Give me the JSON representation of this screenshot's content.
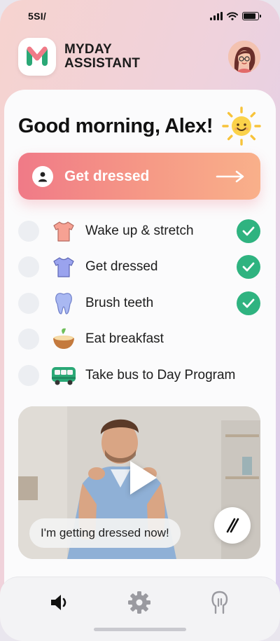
{
  "status_bar": {
    "time": "5SI/"
  },
  "header": {
    "brand_line1": "MYDAY",
    "brand_line2": "ASSISTANT",
    "logo_letter": "M"
  },
  "greeting": "Good morning, Alex!",
  "primary_action": {
    "label": "Get dressed",
    "icon": "person-icon",
    "arrow": "→"
  },
  "tasks": [
    {
      "label": "Wake up & stretch",
      "icon": "shirt-icon",
      "done": true
    },
    {
      "label": "Get dressed",
      "icon": "shirt-icon",
      "done": true
    },
    {
      "label": "Brush teeth",
      "icon": "tooth-icon",
      "done": true
    },
    {
      "label": "Eat breakfast",
      "icon": "bowl-icon",
      "done": false
    },
    {
      "label": "Take bus to Day Program",
      "icon": "bus-icon",
      "done": false
    }
  ],
  "video": {
    "caption": "I'm getting dressed now!"
  },
  "bottom_nav": {
    "items": [
      {
        "name": "speaker-icon"
      },
      {
        "name": "gear-icon"
      },
      {
        "name": "hand-icon"
      }
    ]
  },
  "colors": {
    "accent_start": "#f07a87",
    "accent_end": "#f9b08a",
    "check_green": "#2fb380",
    "logo_green": "#2aa876",
    "logo_pink": "#f07a87"
  }
}
